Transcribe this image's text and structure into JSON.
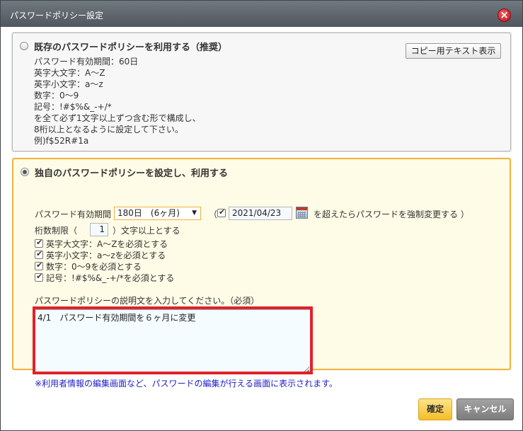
{
  "window": {
    "title": "パスワードポリシー設定",
    "close_icon": "close-icon"
  },
  "existing": {
    "heading": "既存のパスワードポリシーを利用する（推奨）",
    "copy_button": "コピー用テキスト表示",
    "lines": [
      "パスワード有効期間：60日",
      "英字大文字：A～Z",
      "英字小文字：a～z",
      "数字：0～9",
      "記号：!#$%&_-+/*",
      "を全て必ず1文字以上ずつ含む形で構成し、",
      "8桁以上となるように設定して下さい。",
      "例)f$52R#1a"
    ]
  },
  "custom": {
    "heading": "独自のパスワードポリシーを設定し、利用する",
    "validity_label": "パスワード有効期間",
    "validity_value": "180日　(6ヶ月)",
    "open_paren": "（",
    "force_date": "2021/04/23",
    "force_suffix": "を超えたらパスワードを強制変更する ）",
    "length_label": "桁数制限（",
    "length_value": "1",
    "length_suffix": "）文字以上とする",
    "requirements": [
      "英字大文字：A～Zを必須とする",
      "英字小文字：a～zを必須とする",
      "数字：0～9を必須とする",
      "記号：!#$%&_-+/*を必須とする"
    ],
    "description_label": "パスワードポリシーの説明文を入力してください。（必須）",
    "description_value": "4/1　パスワード有効期間を６ヶ月に変更",
    "note": "※利用者情報の編集画面など、パスワードの編集が行える画面に表示されます。"
  },
  "buttons": {
    "ok": "確定",
    "cancel": "キャンセル"
  },
  "colors": {
    "accent": "#f0b23c",
    "highlight": "#e0212b",
    "note": "#2020c8"
  }
}
